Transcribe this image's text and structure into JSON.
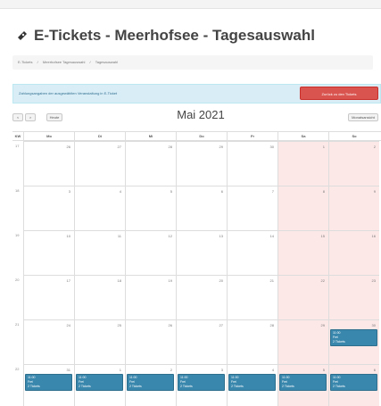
{
  "title": "E-Tickets - Meerhofsee - Tagesauswahl",
  "breadcrumb": [
    "E-Tickets",
    "Meerhofsee Tagesauswahl",
    "Tagesauswahl"
  ],
  "info_bar": {
    "text": "Zahlungsangaben der ausgewählten Veranstaltung in E-Ticket",
    "button": "Zurück zu den Tickets"
  },
  "toolbar": {
    "prev": "<",
    "next": ">",
    "today": "Heute",
    "month_title": "Mai 2021",
    "view": "Monatsansicht"
  },
  "calendar": {
    "week_label": "KW",
    "weekdays": [
      "Mo",
      "Di",
      "Mi",
      "Do",
      "Fr",
      "Sa",
      "So"
    ],
    "weeks": [
      {
        "kw": "17",
        "days": [
          "26",
          "27",
          "28",
          "29",
          "30",
          "1",
          "2"
        ]
      },
      {
        "kw": "18",
        "days": [
          "3",
          "4",
          "5",
          "6",
          "7",
          "8",
          "9"
        ]
      },
      {
        "kw": "19",
        "days": [
          "10",
          "11",
          "12",
          "13",
          "14",
          "15",
          "16"
        ]
      },
      {
        "kw": "20",
        "days": [
          "17",
          "18",
          "19",
          "20",
          "21",
          "22",
          "23"
        ]
      },
      {
        "kw": "21",
        "days": [
          "24",
          "25",
          "26",
          "27",
          "28",
          "29",
          "30"
        ]
      },
      {
        "kw": "22",
        "days": [
          "31",
          "1",
          "2",
          "3",
          "4",
          "5",
          "6"
        ]
      }
    ],
    "events": [
      {
        "week": 4,
        "day": 6,
        "lines": [
          "11:00",
          "Frei",
          "2 Tickets"
        ]
      },
      {
        "week": 5,
        "day": 0,
        "lines": [
          "11:00",
          "Frei",
          "2 Tickets"
        ]
      },
      {
        "week": 5,
        "day": 1,
        "lines": [
          "11:00",
          "Frei",
          "2 Tickets"
        ]
      },
      {
        "week": 5,
        "day": 2,
        "lines": [
          "11:00",
          "Frei",
          "2 Tickets"
        ]
      },
      {
        "week": 5,
        "day": 3,
        "lines": [
          "11:00",
          "Frei",
          "2 Tickets"
        ]
      },
      {
        "week": 5,
        "day": 4,
        "lines": [
          "11:00",
          "Frei",
          "2 Tickets"
        ]
      },
      {
        "week": 5,
        "day": 5,
        "lines": [
          "11:00",
          "Frei",
          "2 Tickets"
        ]
      },
      {
        "week": 5,
        "day": 6,
        "lines": [
          "11:00",
          "Frei",
          "2 Tickets"
        ]
      }
    ]
  },
  "colors": {
    "event": "#3a87ad",
    "weekend": "#fde8e8",
    "info": "#d9edf7",
    "danger": "#d9534f"
  }
}
